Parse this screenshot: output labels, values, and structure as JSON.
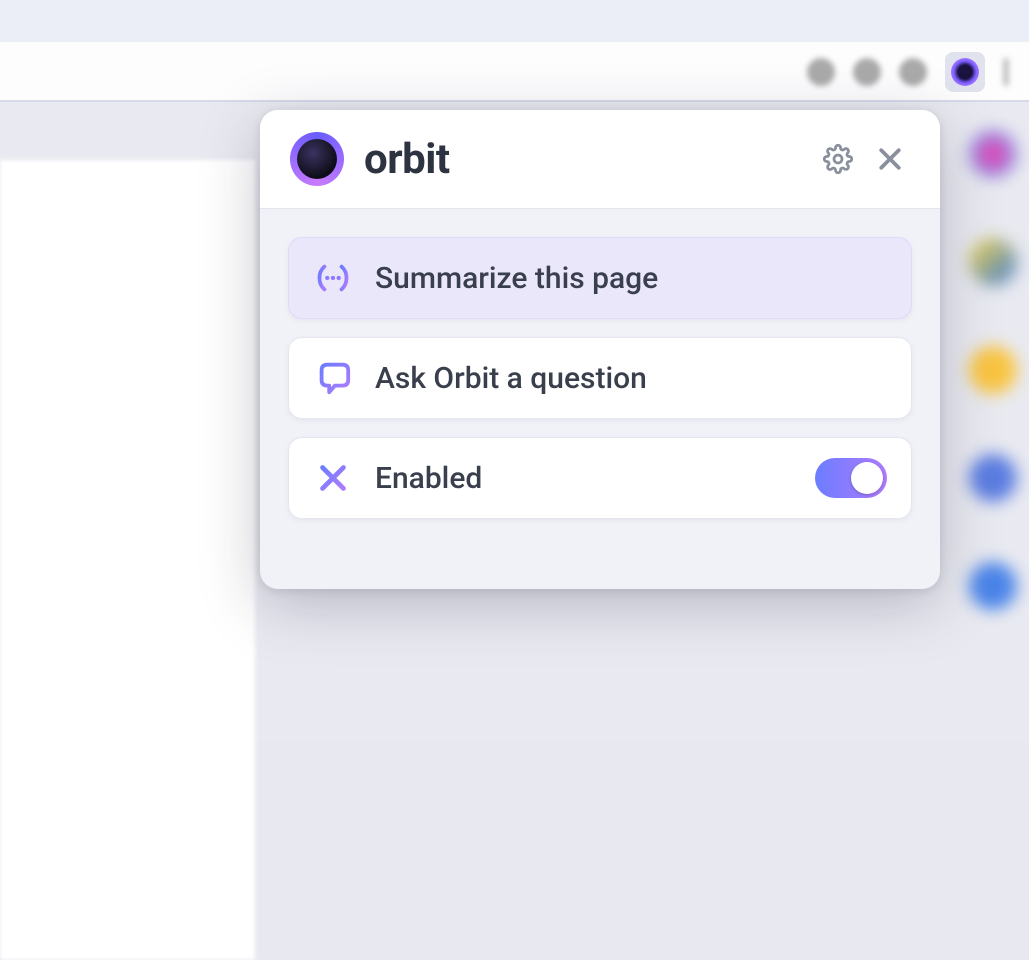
{
  "brand": {
    "name": "orbit"
  },
  "header": {
    "settings_icon": "gear-icon",
    "close_icon": "close-icon"
  },
  "options": {
    "summarize": {
      "label": "Summarize this page",
      "icon": "parentheses-dots-icon"
    },
    "ask": {
      "label": "Ask Orbit a question",
      "icon": "chat-bubble-icon"
    }
  },
  "toggle": {
    "label": "Enabled",
    "icon": "x-icon",
    "state": "on"
  }
}
